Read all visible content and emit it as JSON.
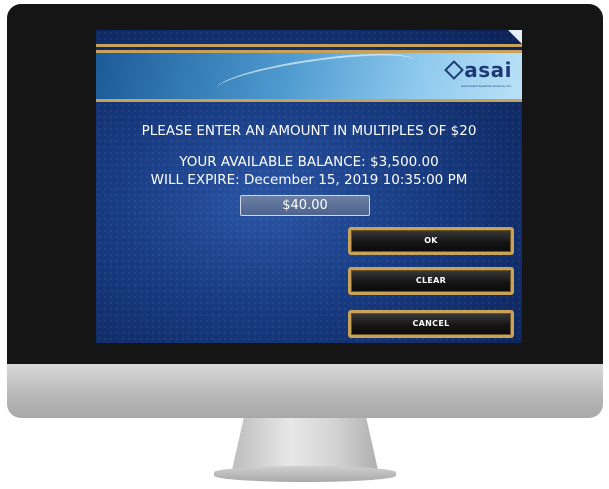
{
  "logo": {
    "text": "asai",
    "tagline": "Automated Systems America, Inc."
  },
  "screen": {
    "prompt": "PLEASE ENTER AN AMOUNT IN MULTIPLES OF $20",
    "balance": "YOUR AVAILABLE BALANCE: $3,500.00",
    "expire": "WILL EXPIRE: December 15, 2019 10:35:00 PM",
    "amount_value": "$40.00"
  },
  "buttons": {
    "ok": "OK",
    "clear": "CLEAR",
    "cancel": "CANCEL"
  },
  "colors": {
    "screen_background": "#173a80",
    "gold_trim": "#c9a25a",
    "header_band": "#4f9bd0",
    "button_face": "#151515"
  }
}
